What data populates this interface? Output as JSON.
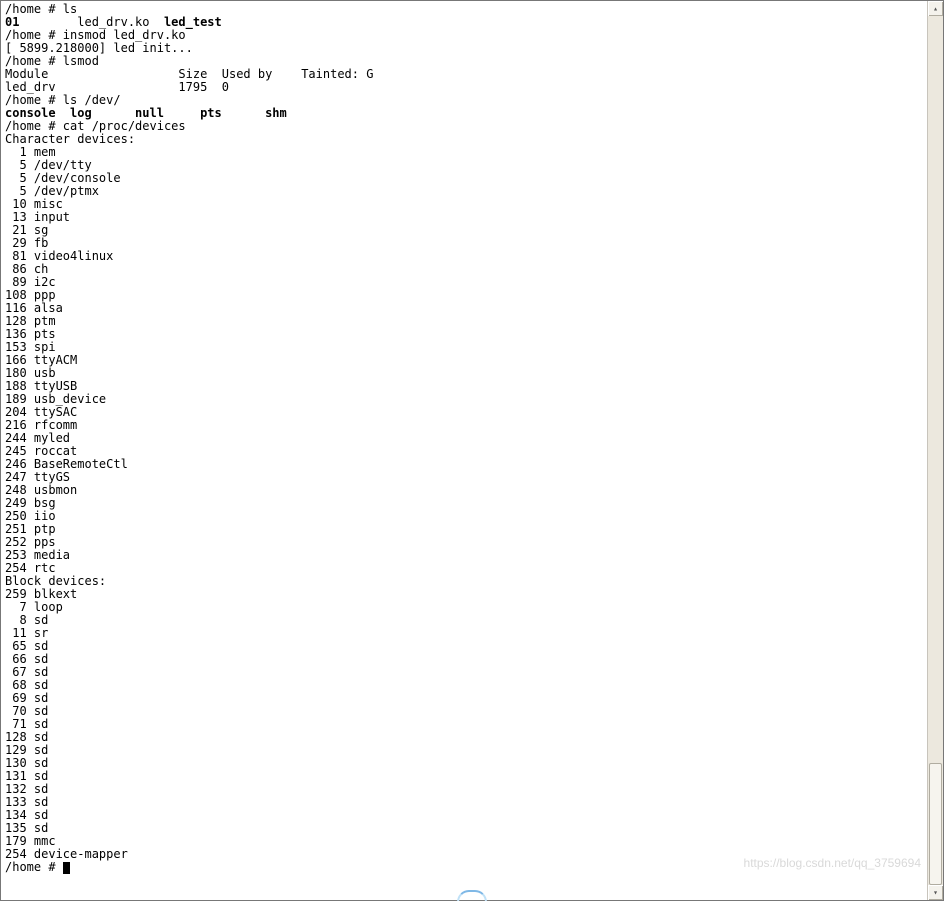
{
  "watermark": "https://blog.csdn.net/qq_3759694",
  "prompt": "/home # ",
  "cursor": true,
  "lines": [
    {
      "segments": [
        {
          "t": "/home # ls"
        }
      ]
    },
    {
      "segments": [
        {
          "t": "01",
          "b": true
        },
        {
          "t": "        led_drv.ko  "
        },
        {
          "t": "led_test",
          "b": true
        }
      ]
    },
    {
      "segments": [
        {
          "t": "/home # insmod led_drv.ko"
        }
      ]
    },
    {
      "segments": [
        {
          "t": "[ 5899.218000] led init..."
        }
      ]
    },
    {
      "segments": [
        {
          "t": "/home # lsmod"
        }
      ]
    },
    {
      "segments": [
        {
          "t": "Module                  Size  Used by    Tainted: G"
        }
      ]
    },
    {
      "segments": [
        {
          "t": "led_drv                 1795  0"
        }
      ]
    },
    {
      "segments": [
        {
          "t": "/home # ls /dev/"
        }
      ]
    },
    {
      "segments": [
        {
          "t": "console  log      null     pts      shm",
          "b": true
        }
      ]
    },
    {
      "segments": [
        {
          "t": "/home # cat /proc/devices"
        }
      ]
    },
    {
      "segments": [
        {
          "t": "Character devices:"
        }
      ]
    },
    {
      "segments": [
        {
          "t": "  1 mem"
        }
      ]
    },
    {
      "segments": [
        {
          "t": "  5 /dev/tty"
        }
      ]
    },
    {
      "segments": [
        {
          "t": "  5 /dev/console"
        }
      ]
    },
    {
      "segments": [
        {
          "t": "  5 /dev/ptmx"
        }
      ]
    },
    {
      "segments": [
        {
          "t": " 10 misc"
        }
      ]
    },
    {
      "segments": [
        {
          "t": " 13 input"
        }
      ]
    },
    {
      "segments": [
        {
          "t": " 21 sg"
        }
      ]
    },
    {
      "segments": [
        {
          "t": " 29 fb"
        }
      ]
    },
    {
      "segments": [
        {
          "t": " 81 video4linux"
        }
      ]
    },
    {
      "segments": [
        {
          "t": " 86 ch"
        }
      ]
    },
    {
      "segments": [
        {
          "t": " 89 i2c"
        }
      ]
    },
    {
      "segments": [
        {
          "t": "108 ppp"
        }
      ]
    },
    {
      "segments": [
        {
          "t": "116 alsa"
        }
      ]
    },
    {
      "segments": [
        {
          "t": "128 ptm"
        }
      ]
    },
    {
      "segments": [
        {
          "t": "136 pts"
        }
      ]
    },
    {
      "segments": [
        {
          "t": "153 spi"
        }
      ]
    },
    {
      "segments": [
        {
          "t": "166 ttyACM"
        }
      ]
    },
    {
      "segments": [
        {
          "t": "180 usb"
        }
      ]
    },
    {
      "segments": [
        {
          "t": "188 ttyUSB"
        }
      ]
    },
    {
      "segments": [
        {
          "t": "189 usb_device"
        }
      ]
    },
    {
      "segments": [
        {
          "t": "204 ttySAC"
        }
      ]
    },
    {
      "segments": [
        {
          "t": "216 rfcomm"
        }
      ]
    },
    {
      "segments": [
        {
          "t": "244 myled"
        }
      ]
    },
    {
      "segments": [
        {
          "t": "245 roccat"
        }
      ]
    },
    {
      "segments": [
        {
          "t": "246 BaseRemoteCtl"
        }
      ]
    },
    {
      "segments": [
        {
          "t": "247 ttyGS"
        }
      ]
    },
    {
      "segments": [
        {
          "t": "248 usbmon"
        }
      ]
    },
    {
      "segments": [
        {
          "t": "249 bsg"
        }
      ]
    },
    {
      "segments": [
        {
          "t": "250 iio"
        }
      ]
    },
    {
      "segments": [
        {
          "t": "251 ptp"
        }
      ]
    },
    {
      "segments": [
        {
          "t": "252 pps"
        }
      ]
    },
    {
      "segments": [
        {
          "t": "253 media"
        }
      ]
    },
    {
      "segments": [
        {
          "t": "254 rtc"
        }
      ]
    },
    {
      "segments": [
        {
          "t": ""
        }
      ]
    },
    {
      "segments": [
        {
          "t": "Block devices:"
        }
      ]
    },
    {
      "segments": [
        {
          "t": "259 blkext"
        }
      ]
    },
    {
      "segments": [
        {
          "t": "  7 loop"
        }
      ]
    },
    {
      "segments": [
        {
          "t": "  8 sd"
        }
      ]
    },
    {
      "segments": [
        {
          "t": " 11 sr"
        }
      ]
    },
    {
      "segments": [
        {
          "t": " 65 sd"
        }
      ]
    },
    {
      "segments": [
        {
          "t": " 66 sd"
        }
      ]
    },
    {
      "segments": [
        {
          "t": " 67 sd"
        }
      ]
    },
    {
      "segments": [
        {
          "t": " 68 sd"
        }
      ]
    },
    {
      "segments": [
        {
          "t": " 69 sd"
        }
      ]
    },
    {
      "segments": [
        {
          "t": " 70 sd"
        }
      ]
    },
    {
      "segments": [
        {
          "t": " 71 sd"
        }
      ]
    },
    {
      "segments": [
        {
          "t": "128 sd"
        }
      ]
    },
    {
      "segments": [
        {
          "t": "129 sd"
        }
      ]
    },
    {
      "segments": [
        {
          "t": "130 sd"
        }
      ]
    },
    {
      "segments": [
        {
          "t": "131 sd"
        }
      ]
    },
    {
      "segments": [
        {
          "t": "132 sd"
        }
      ]
    },
    {
      "segments": [
        {
          "t": "133 sd"
        }
      ]
    },
    {
      "segments": [
        {
          "t": "134 sd"
        }
      ]
    },
    {
      "segments": [
        {
          "t": "135 sd"
        }
      ]
    },
    {
      "segments": [
        {
          "t": "179 mmc"
        }
      ]
    },
    {
      "segments": [
        {
          "t": "254 device-mapper"
        }
      ]
    }
  ]
}
